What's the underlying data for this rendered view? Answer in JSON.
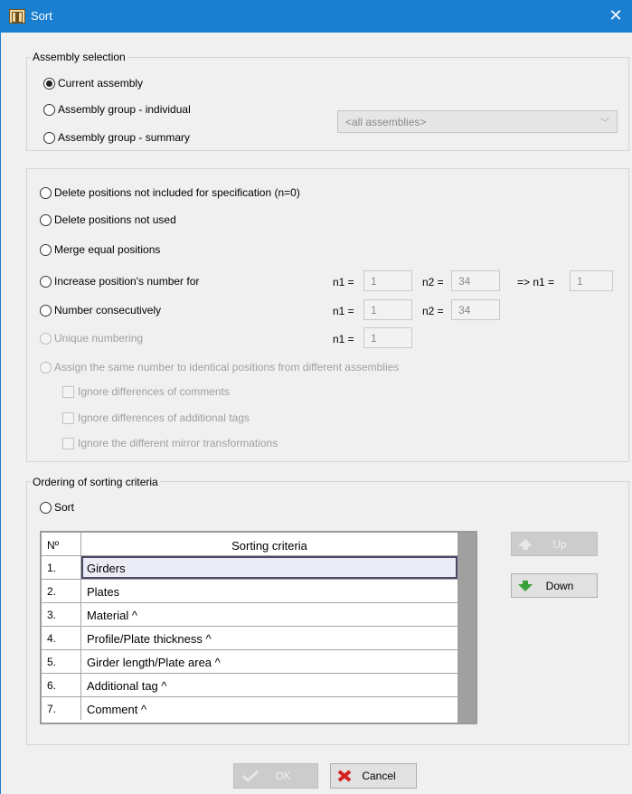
{
  "window": {
    "title": "Sort",
    "close_glyph": "✕"
  },
  "assembly_selection": {
    "legend": "Assembly selection",
    "options": [
      {
        "label": "Current assembly",
        "checked": true
      },
      {
        "label": "Assembly group - individual",
        "checked": false
      },
      {
        "label": "Assembly group - summary",
        "checked": false
      }
    ],
    "combo": {
      "value": "<all assemblies>",
      "arrow": "﹀",
      "disabled": true
    }
  },
  "operations": {
    "options": [
      {
        "label": "Delete positions not included for specification (n=0)",
        "checked": false,
        "disabled": false
      },
      {
        "label": "Delete positions not used",
        "checked": false,
        "disabled": false
      },
      {
        "label": "Merge equal positions",
        "checked": false,
        "disabled": false
      },
      {
        "label": "Increase position's number for",
        "checked": false,
        "disabled": false
      },
      {
        "label": "Number consecutively",
        "checked": false,
        "disabled": false
      },
      {
        "label": "Unique numbering",
        "checked": false,
        "disabled": true
      },
      {
        "label": "Assign the same number to identical positions from different assemblies",
        "checked": false,
        "disabled": true
      }
    ],
    "increase": {
      "n1_label": "n1 =",
      "n1": "1",
      "n2_label": "n2 =",
      "n2": "34",
      "result_label": "=> n1 =",
      "result": "1"
    },
    "consecutive": {
      "n1_label": "n1 =",
      "n1": "1",
      "n2_label": "n2 =",
      "n2": "34"
    },
    "unique": {
      "n1_label": "n1 =",
      "n1": "1"
    },
    "checkboxes": [
      {
        "label": "Ignore differences of comments",
        "checked": false
      },
      {
        "label": "Ignore differences of additional tags",
        "checked": false
      },
      {
        "label": "Ignore the different mirror transformations",
        "checked": false
      }
    ]
  },
  "ordering": {
    "legend": "Ordering of sorting criteria",
    "sort_option": {
      "label": "Sort",
      "checked": false
    },
    "table": {
      "headers": {
        "no": "Nº",
        "criteria": "Sorting criteria"
      },
      "rows": [
        {
          "no": "1.",
          "criteria": "Girders",
          "selected": true
        },
        {
          "no": "2.",
          "criteria": "Plates",
          "selected": false
        },
        {
          "no": "3.",
          "criteria": "Material  ^",
          "selected": false
        },
        {
          "no": "4.",
          "criteria": "Profile/Plate thickness  ^",
          "selected": false
        },
        {
          "no": "5.",
          "criteria": "Girder length/Plate area  ^",
          "selected": false
        },
        {
          "no": "6.",
          "criteria": "Additional tag  ^",
          "selected": false
        },
        {
          "no": "7.",
          "criteria": "Comment  ^",
          "selected": false
        }
      ]
    },
    "up_button": {
      "label": "Up",
      "icon": "arrow-up-icon",
      "disabled": true
    },
    "down_button": {
      "label": "Down",
      "icon": "arrow-down-icon",
      "disabled": false
    }
  },
  "footer": {
    "ok_button": {
      "label": "OK",
      "icon": "check-icon",
      "disabled": true
    },
    "cancel_button": {
      "label": "Cancel",
      "icon": "cross-icon",
      "disabled": false
    }
  },
  "colors": {
    "titlebar": "#1a7fd0",
    "down_arrow": "#3aa23a",
    "cancel_cross": "#d42020"
  }
}
